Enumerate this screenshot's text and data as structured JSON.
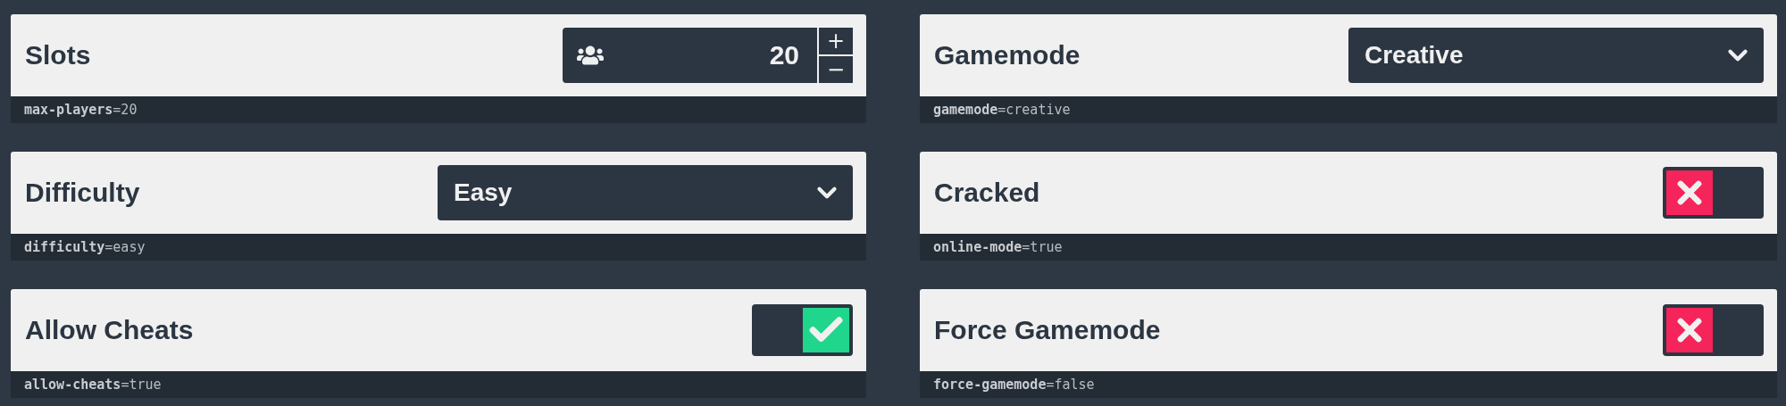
{
  "settings": [
    {
      "title": "Slots",
      "kind": "number",
      "value": "20",
      "increment": "+",
      "decrement": "−",
      "property": "**max-players**=20"
    },
    {
      "title": "Gamemode",
      "kind": "select",
      "value": "Creative",
      "property": "**gamemode**=creative"
    },
    {
      "title": "Difficulty",
      "kind": "select",
      "value": "Easy",
      "property": "**difficulty**=easy"
    },
    {
      "title": "Cracked",
      "kind": "toggle",
      "on": false,
      "property": "**online-mode**=true"
    },
    {
      "title": "Allow Cheats",
      "kind": "toggle",
      "on": true,
      "property": "**allow-cheats**=true"
    },
    {
      "title": "Force Gamemode",
      "kind": "toggle",
      "on": false,
      "property": "**force-gamemode**=false"
    }
  ]
}
